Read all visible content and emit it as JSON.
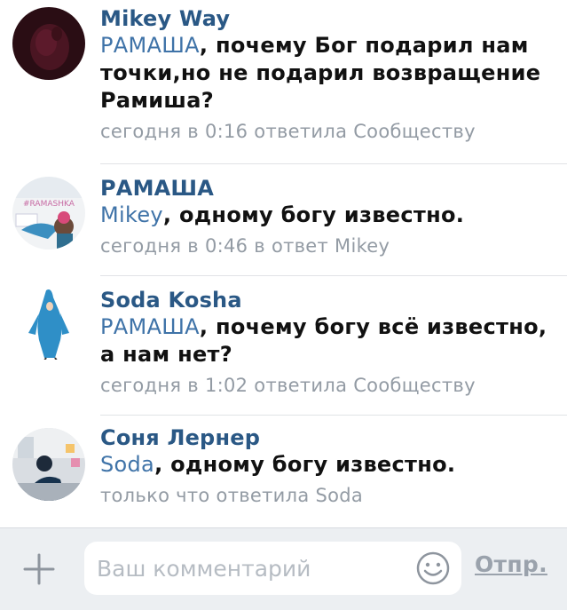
{
  "comments": [
    {
      "author": "Mikey Way",
      "reply_to": "РАМАША",
      "text": ", почему Бог подарил нам точки,но не подарил возвращение Рамиша?",
      "meta": "сегодня в 0:16 ответила Сообществу",
      "avatar_icon": "dark-portrait-avatar"
    },
    {
      "author": "РАМАША",
      "reply_to": "Mikey",
      "text": ", одному богу известно.",
      "meta": "сегодня в 0:46 в ответ Mikey",
      "avatar_icon": "collage-avatar",
      "avatar_text": "#RAMASHKA"
    },
    {
      "author": "Soda Kosha",
      "reply_to": "РАМАША",
      "text": ", почему богу всё известно, а нам нет?",
      "meta": "сегодня в 1:02 ответила Сообществу",
      "avatar_icon": "dolphin-costume-avatar"
    },
    {
      "author": "Соня Лернер",
      "reply_to": "Soda",
      "text": ", одному богу известно.",
      "meta": "только что ответила Soda",
      "avatar_icon": "office-photo-avatar"
    }
  ],
  "composer": {
    "placeholder": "Ваш комментарий",
    "send_label": "Отпр.",
    "attach_icon": "plus-icon",
    "emoji_icon": "smile-icon"
  },
  "colors": {
    "author": "#2a5885",
    "mention": "#3f73a8",
    "meta": "#939ba4",
    "composer_bg": "#eceff2"
  }
}
